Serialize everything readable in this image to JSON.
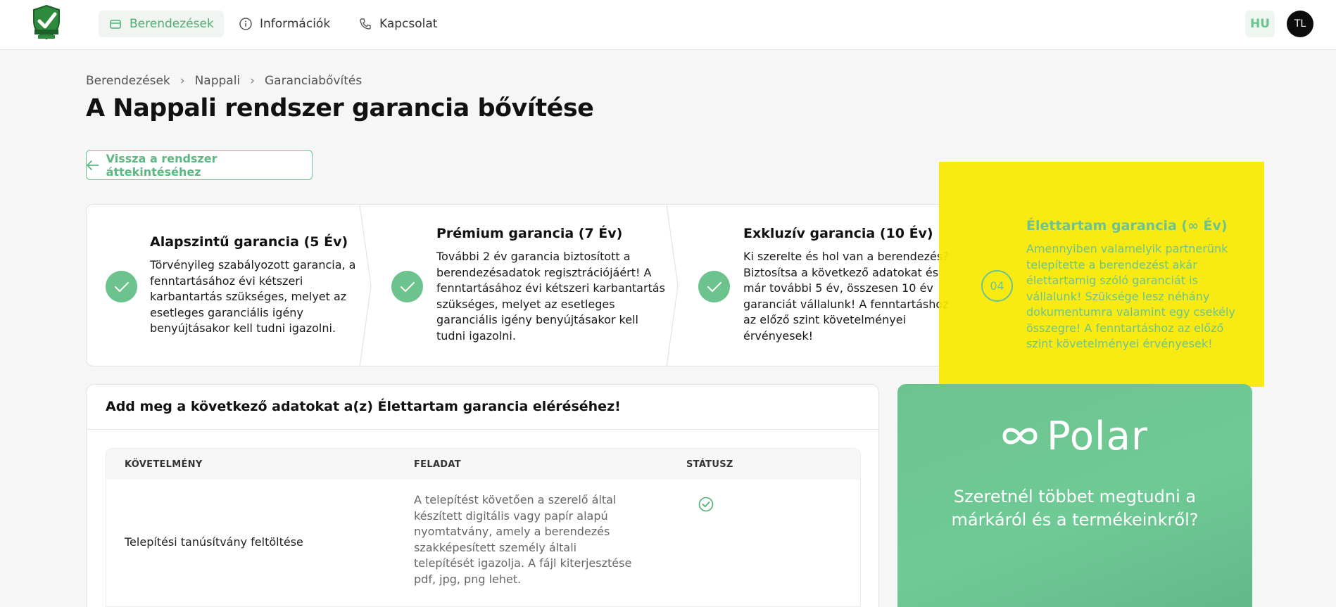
{
  "nav": {
    "items": [
      {
        "label": "Berendezések",
        "icon": "box-icon",
        "active": true
      },
      {
        "label": "Információk",
        "icon": "info-icon",
        "active": false
      },
      {
        "label": "Kapcsolat",
        "icon": "phone-icon",
        "active": false
      }
    ],
    "lang": "HU",
    "avatar": "TL"
  },
  "breadcrumb": [
    "Berendezések",
    "Nappali",
    "Garanciabővítés"
  ],
  "page_title": "A Nappali rendszer garancia bővítése",
  "back_label": "Vissza a rendszer áttekintéséhez",
  "steps": [
    {
      "title": "Alapszintű garancia (5 Év)",
      "desc": "Törvényileg szabályozott garancia, a fenntartásához évi kétszeri karbantartás szükséges, melyet az esetleges garanciális igény benyújtásakor kell tudni igazolni.",
      "state": "done"
    },
    {
      "title": "Prémium garancia (7 Év)",
      "desc": "További 2 év garancia biztosított a berendezésadatok regisztrációjáért! A fenntartásához évi kétszeri karbantartás szükséges, melyet az esetleges garanciális igény benyújtásakor kell tudni igazolni.",
      "state": "done"
    },
    {
      "title": "Exkluzív garancia (10 Év)",
      "desc": "Ki szerelte és hol van a berendezés? Biztosítsa a következő adatokat és már további 5 év, összesen 10 év garanciát vállalunk! A fenntartáshoz az előző szint követelményei érvényesek!",
      "state": "done"
    },
    {
      "title": "Élettartam garancia (∞ Év)",
      "desc": "Amennyiben valamelyik partnerünk telepítette a berendezést akár élettartamig szóló garanciát is vállalunk! Szüksége lesz néhány dokumentumra valamint egy csekély összegre! A fenntartáshoz az előző szint követelményei érvényesek!",
      "state": "current",
      "number": "04"
    }
  ],
  "requirements": {
    "heading": "Add meg a következő adatokat a(z) Élettartam garancia eléréséhez!",
    "columns": [
      "KÖVETELMÉNY",
      "FELADAT",
      "STÁTUSZ"
    ],
    "rows": [
      {
        "requirement": "Telepítési tanúsítvány feltöltése",
        "task": "A telepítést követően a szerelő által készített digitális vagy papír alapú nyomtatvány, amely a berendezés szakképesített személy általi telepítését igazolja. A fájl kiterjesztése pdf, jpg, png lehet.",
        "status": "done"
      }
    ]
  },
  "promo": {
    "brand": "Polar",
    "text": "Szeretnél többet megtudni a márkáról és a termékeinkről?"
  },
  "colors": {
    "accent": "#6cc38d",
    "highlight": "#f8e800",
    "text": "#111111"
  }
}
